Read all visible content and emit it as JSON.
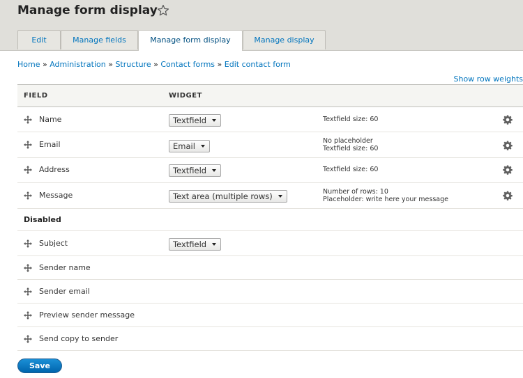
{
  "page": {
    "title": "Manage form display"
  },
  "tabs": [
    {
      "label": "Edit"
    },
    {
      "label": "Manage fields"
    },
    {
      "label": "Manage form display"
    },
    {
      "label": "Manage display"
    }
  ],
  "breadcrumb": {
    "separator": "»",
    "items": [
      {
        "label": "Home"
      },
      {
        "label": "Administration"
      },
      {
        "label": "Structure"
      },
      {
        "label": "Contact forms"
      },
      {
        "label": "Edit contact form"
      }
    ]
  },
  "show_row_weights": "Show row weights",
  "table": {
    "headers": {
      "field": "FIELD",
      "widget": "WIDGET"
    },
    "rows": [
      {
        "label": "Name",
        "widget": "Textfield",
        "summary": [
          "Textfield size: 60"
        ]
      },
      {
        "label": "Email",
        "widget": "Email",
        "summary": [
          "No placeholder",
          "Textfield size: 60"
        ]
      },
      {
        "label": "Address",
        "widget": "Textfield",
        "summary": [
          "Textfield size: 60"
        ]
      },
      {
        "label": "Message",
        "widget": "Text area (multiple rows)",
        "summary": [
          "Number of rows: 10",
          "Placeholder: write here your message"
        ]
      }
    ],
    "disabled_title": "Disabled",
    "disabled_rows": [
      {
        "label": "Subject",
        "widget": "Textfield"
      },
      {
        "label": "Sender name"
      },
      {
        "label": "Sender email"
      },
      {
        "label": "Preview sender message"
      },
      {
        "label": "Send copy to sender"
      }
    ]
  },
  "buttons": {
    "save": "Save"
  },
  "colors": {
    "link": "#0074bd",
    "header_bg": "#e0dfda",
    "primary_button": "#0074bd"
  },
  "icons": {
    "favorite": "star-outline-icon",
    "drag": "drag-handle-icon",
    "settings": "gear-icon"
  }
}
